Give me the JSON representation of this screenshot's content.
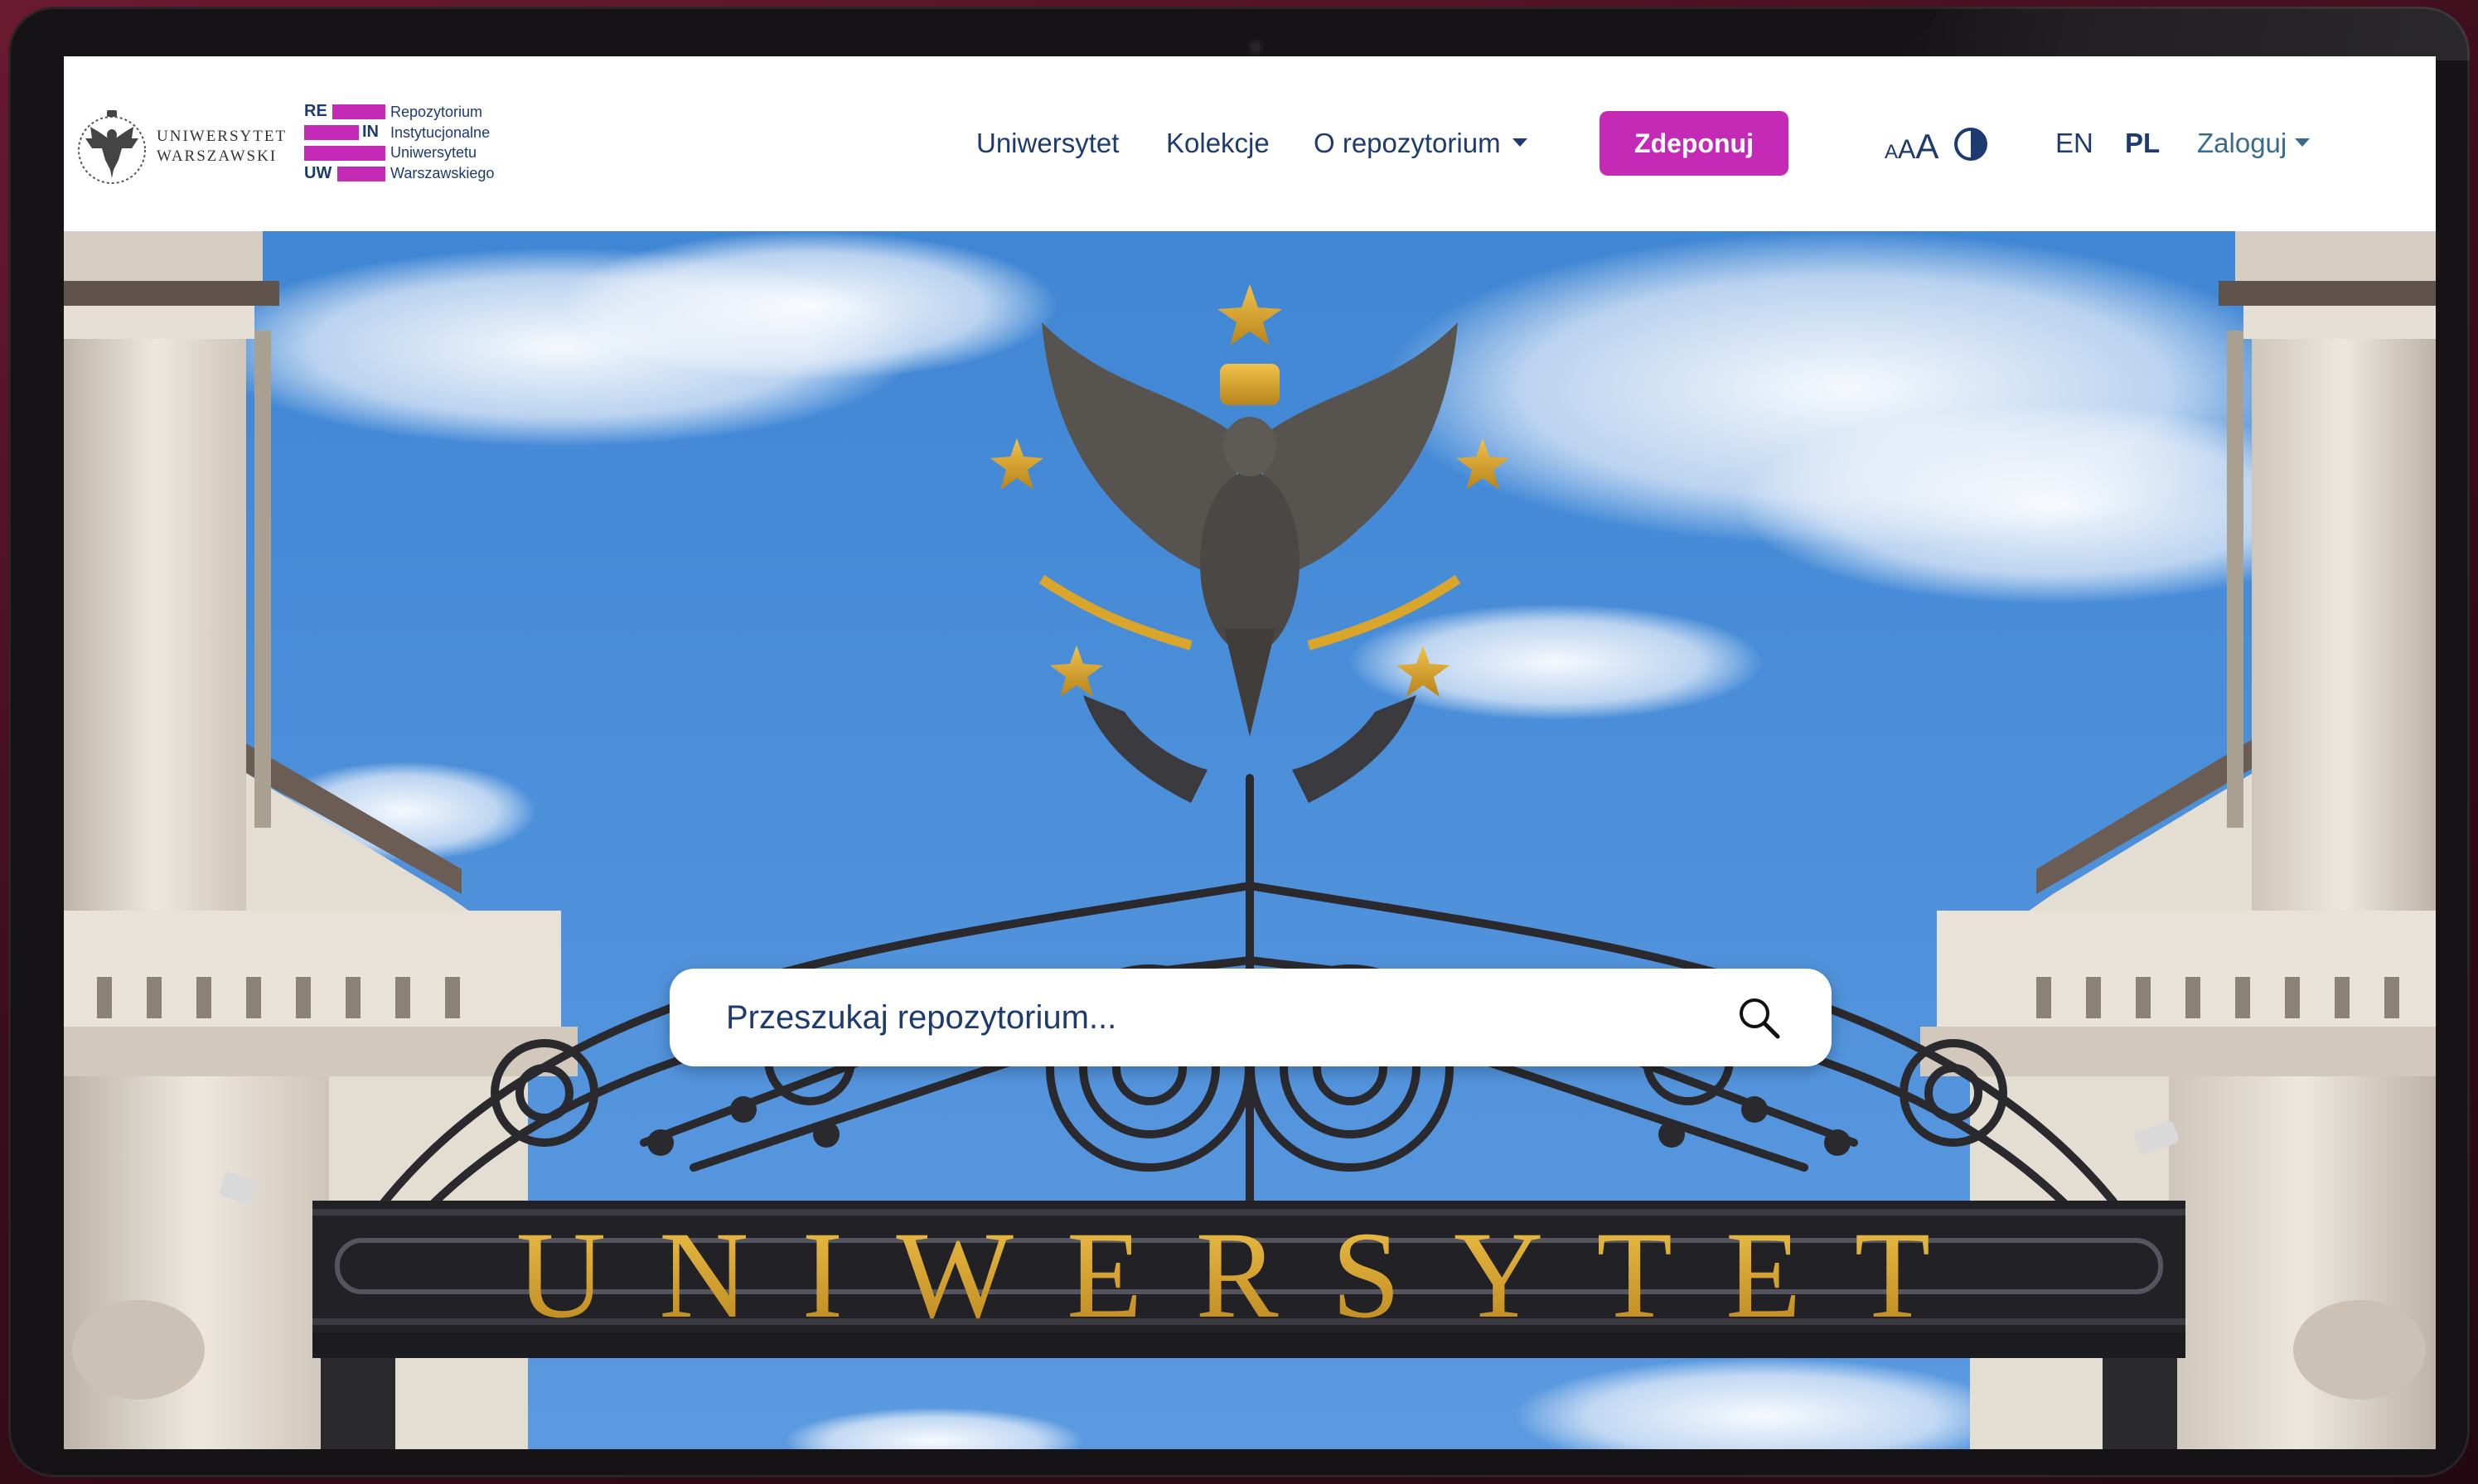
{
  "branding": {
    "university_name_line1": "UNIWERSYTET",
    "university_name_line2": "WARSZAWSKI",
    "rein_tags": [
      "RE",
      "IN",
      "UW"
    ],
    "rein_text": [
      "Repozytorium",
      "Instytucjonalne",
      "Uniwersytetu",
      "Warszawskiego"
    ],
    "accent_color": "#c42ab6",
    "text_color": "#1d3b6e"
  },
  "nav": {
    "items": [
      {
        "label": "Uniwersytet"
      },
      {
        "label": "Kolekcje"
      },
      {
        "label": "O repozytorium",
        "has_dropdown": true
      }
    ],
    "deposit_label": "Zdeponuj",
    "font_size_labels": [
      "A",
      "A",
      "A"
    ],
    "contrast_icon": "contrast-icon",
    "languages": {
      "en": "EN",
      "pl": "PL",
      "active": "PL"
    },
    "login_label": "Zaloguj"
  },
  "hero": {
    "gate_lettering": "UNIWERSYTET",
    "search": {
      "placeholder": "Przeszukaj repozytorium...",
      "value": "",
      "icon": "search-icon"
    }
  }
}
